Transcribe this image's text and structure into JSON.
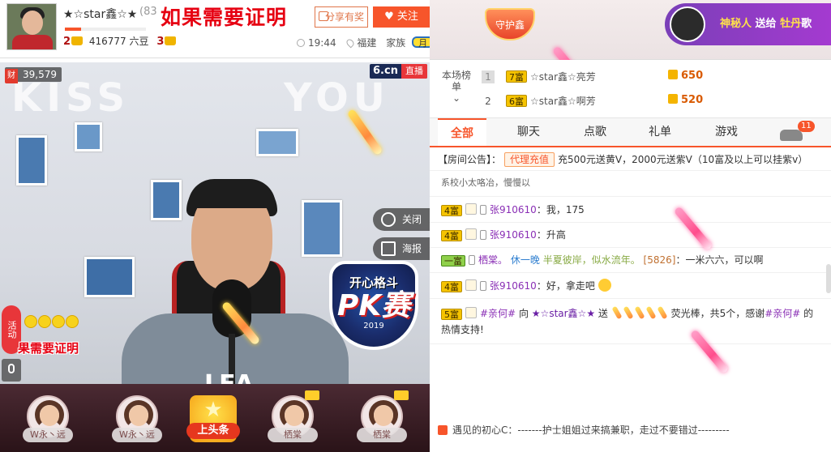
{
  "header": {
    "anchor_name": "★☆star鑫☆★",
    "anchor_id": "(83",
    "overlay_title": "如果需要证明",
    "share_label": "分享有奖",
    "follow_label": "关注",
    "follow_icon": "heart-icon",
    "level_left": "2",
    "beans": "416777 六豆",
    "level_right": "3",
    "time": "19:44",
    "location": "福建",
    "family": "家族",
    "month_badge": "月"
  },
  "video": {
    "viewer_count": "39,579",
    "viewer_icon": "财",
    "brand": "6.cn",
    "live_label": "直播",
    "kiss_text": "KISS",
    "you_text": "YOU",
    "close_label": "关闭",
    "poster_label": "海报",
    "pk_line1": "开心格斗",
    "pk_line2": "PK赛",
    "pk_year": "2019",
    "shirt_text": "LEA",
    "activity_label": "活动",
    "overlay_title_bottom": "果需要证明"
  },
  "guards": [
    {
      "name": "W永丶远"
    },
    {
      "name": "W永丶远"
    },
    {
      "name": "栖棠"
    },
    {
      "name": "栖棠"
    }
  ],
  "headline_label": "上头条",
  "guardian_badge": "守护鑫",
  "broadcast": {
    "prefix": "神秘人",
    "verb": "送给",
    "target": "牡丹",
    "suffix": "歌"
  },
  "ranking": {
    "label": "本场榜单",
    "rows": [
      {
        "rank": "1",
        "wealth": "7富",
        "name": "☆star鑫☆亮芳",
        "score": "650"
      },
      {
        "rank": "2",
        "wealth": "6富",
        "name": "☆star鑫☆啊芳",
        "score": "520"
      }
    ]
  },
  "tabs": [
    "全部",
    "聊天",
    "点歌",
    "礼单",
    "游戏"
  ],
  "car_count": "11",
  "chat": {
    "notice_prefix": "【房间公告】：",
    "notice_tag": "代理充值",
    "notice_text": "充500元送黄V，2000元送紫V（10富及以上可以挂紫v）",
    "cut_line": "系校小太咯冶，慢慢以",
    "messages": [
      {
        "wealth": "4富",
        "user": "张910610",
        "text": "：我，175"
      },
      {
        "wealth": "4富",
        "user": "张910610",
        "text": "：升高"
      },
      {
        "wealth": "一富",
        "user": "栖棠。",
        "fan": "休一晚",
        "sig": "半夏彼岸，似水流年。",
        "rid": "[5826]",
        "text": "：一米六六，可以啊"
      },
      {
        "wealth": "4富",
        "user": "张910610",
        "text": "：好，拿走吧"
      },
      {
        "wealth": "5富",
        "user": "#亲何#",
        "verb": "向",
        "target": "★☆star鑫☆★",
        "verb2": "送",
        "gift": "荧光棒，共5个，感谢",
        "thanks_user": "#亲何#",
        "thanks_text": "的热情支持!"
      }
    ]
  },
  "bottom_notice": "遇见的初心C：-------护士姐姐过来搞兼职，走过不要错过---------"
}
